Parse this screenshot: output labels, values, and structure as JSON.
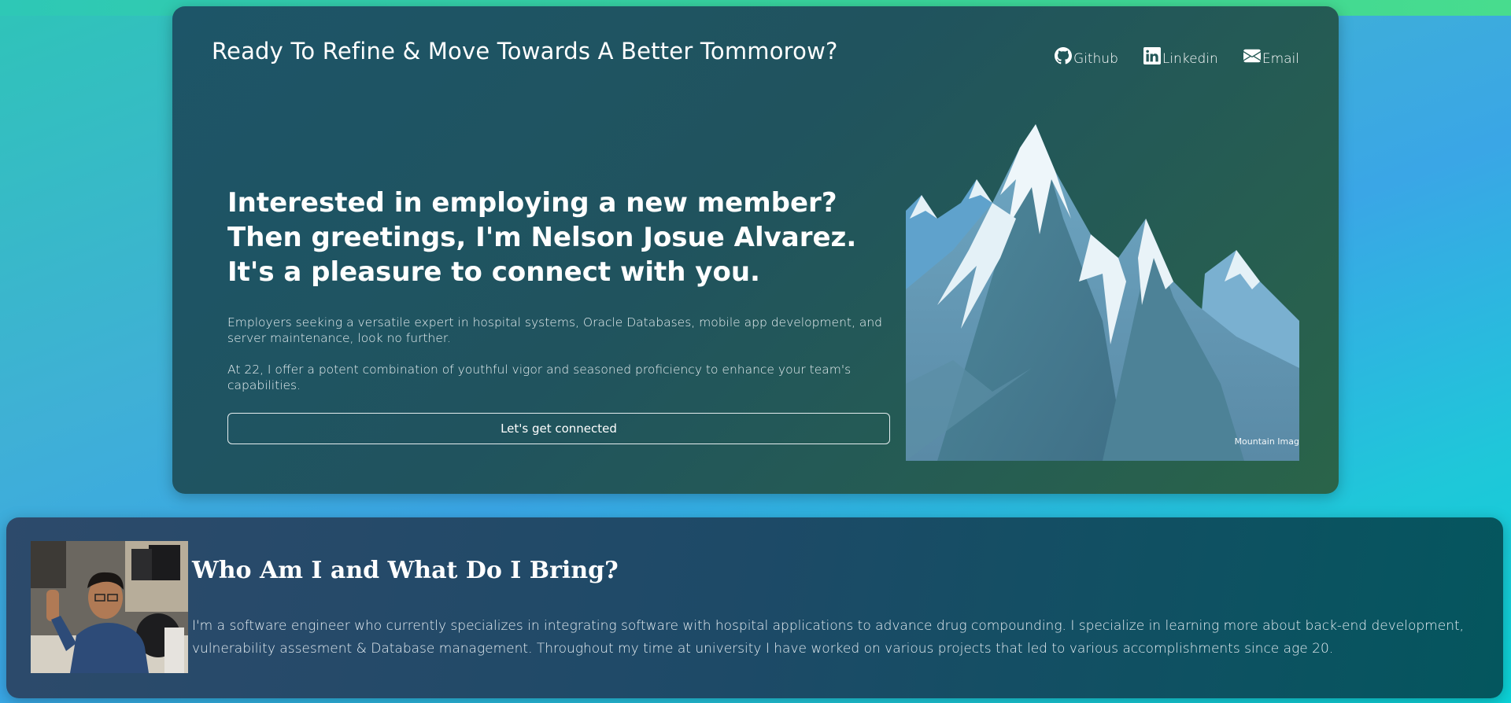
{
  "hero": {
    "title": "Ready To Refine & Move Towards A Better Tommorow?",
    "links": [
      {
        "label": "Github",
        "icon": "github-icon"
      },
      {
        "label": "Linkedin",
        "icon": "linkedin-icon"
      },
      {
        "label": "Email",
        "icon": "email-icon"
      }
    ],
    "headline_line1": "Interested in employing a new member?",
    "headline_line2": "Then greetings, I'm Nelson Josue Alvarez. It's a pleasure to connect with you.",
    "paragraph1": "Employers seeking a versatile expert in hospital systems, Oracle Databases, mobile app development, and server maintenance, look no further.",
    "paragraph2": "At 22, I offer a potent combination of youthful vigor and seasoned proficiency to enhance your team's capabilities.",
    "cta_label": "Let's get connected",
    "image_caption": "Mountain Imag"
  },
  "about": {
    "title": "Who Am I and What Do I Bring?",
    "text": "I'm a software engineer who currently specializes in integrating software with hospital applications to advance drug compounding. I specialize in learning more about back-end development, vulnerability assesment & Database management. Throughout my time at university I have worked on various projects that led to various accomplishments since age 20."
  },
  "colors": {
    "hero_bg_start": "#1d5568",
    "hero_bg_end": "#2a6449",
    "about_bg_start": "#2d4a6b",
    "about_bg_end": "#04565e"
  }
}
